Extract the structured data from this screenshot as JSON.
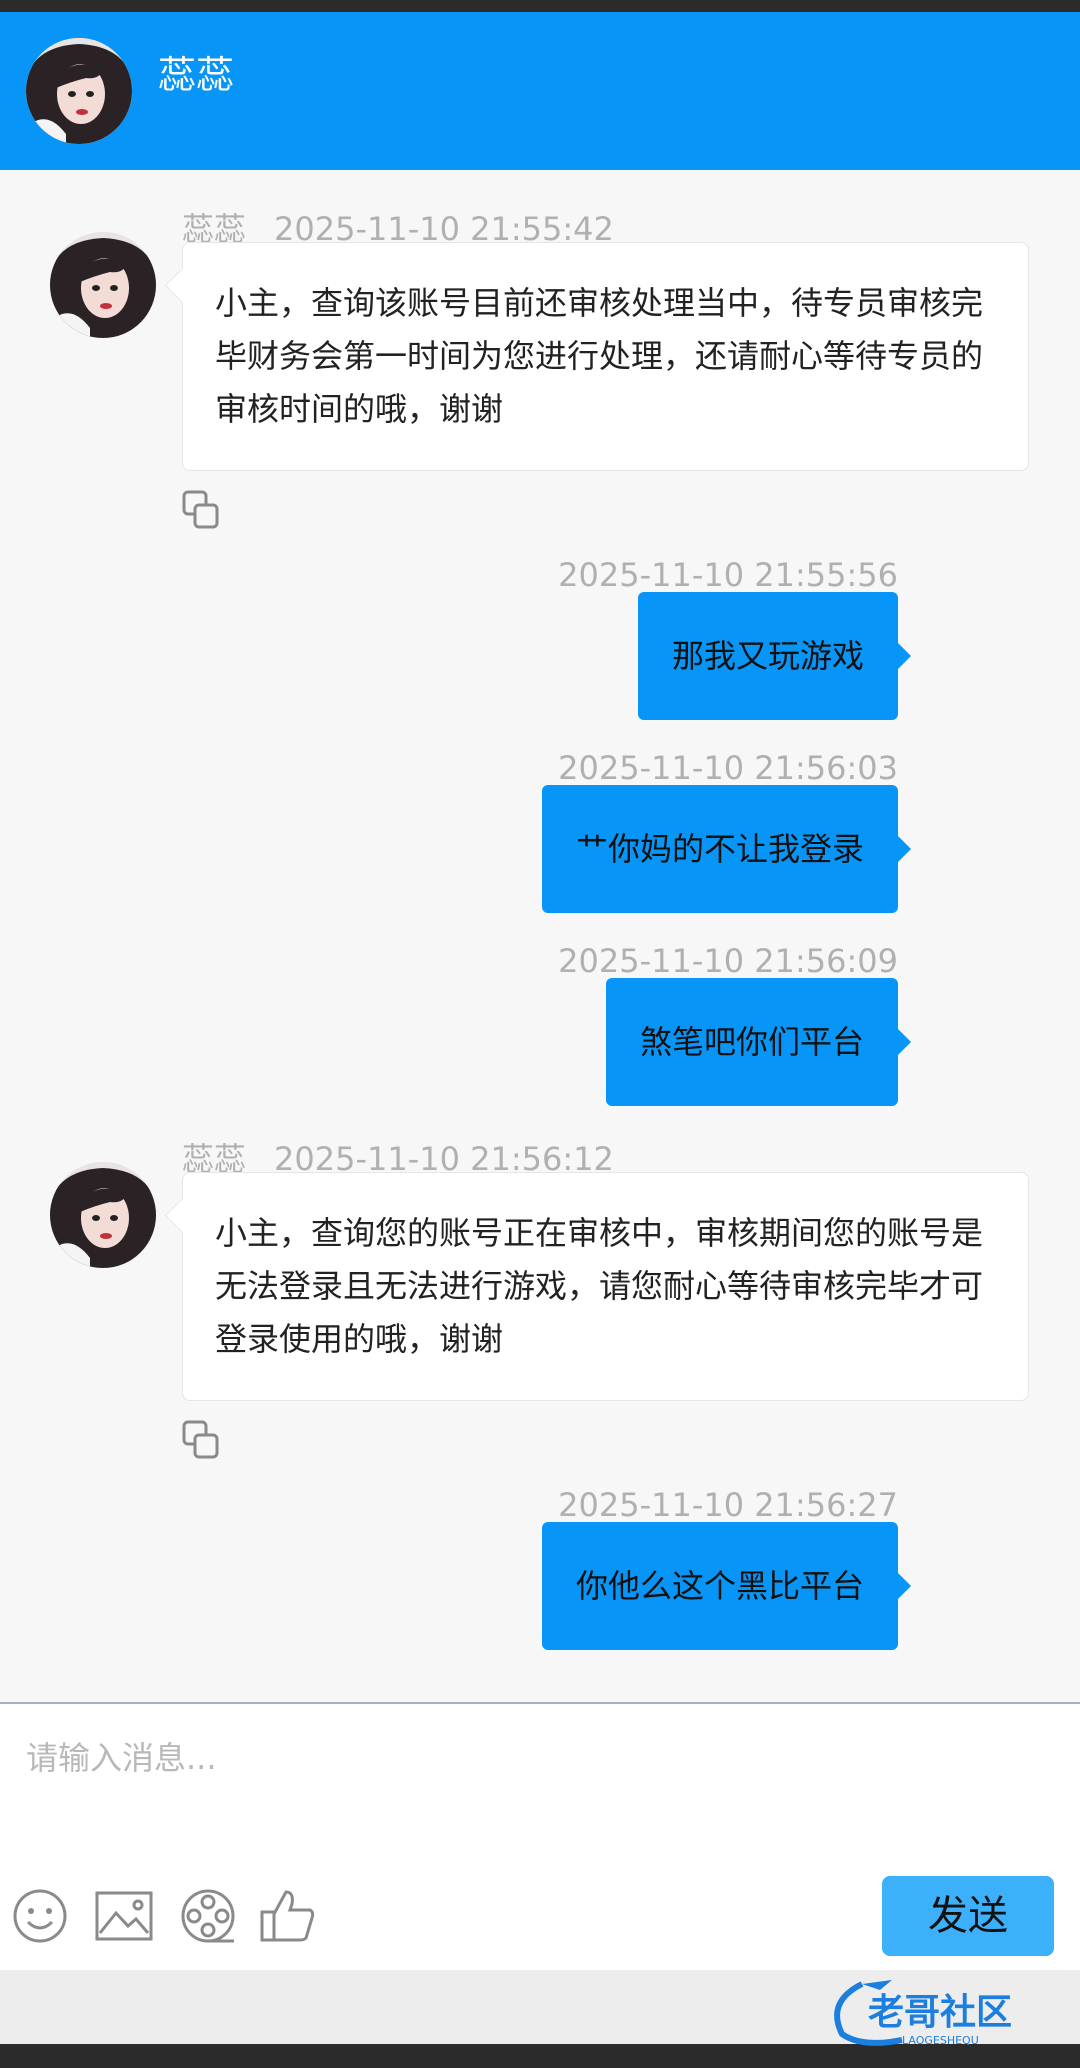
{
  "header": {
    "name": "蕊蕊"
  },
  "messages": [
    {
      "direction": "in",
      "sender": "蕊蕊",
      "time": "2025-11-10 21:55:42",
      "text": "小主，查询该账号目前还审核处理当中，待专员审核完毕财务会第一时间为您进行处理，还请耐心等待专员的审核时间的哦，谢谢"
    },
    {
      "direction": "out",
      "time": "2025-11-10 21:55:56",
      "text": "那我又玩游戏"
    },
    {
      "direction": "out",
      "time": "2025-11-10 21:56:03",
      "text": "艹你妈的不让我登录"
    },
    {
      "direction": "out",
      "time": "2025-11-10 21:56:09",
      "text": "煞笔吧你们平台"
    },
    {
      "direction": "in",
      "sender": "蕊蕊",
      "time": "2025-11-10 21:56:12",
      "text": "小主，查询您的账号正在审核中，审核期间您的账号是无法登录且无法进行游戏，请您耐心等待审核完毕才可登录使用的哦，谢谢"
    },
    {
      "direction": "out",
      "time": "2025-11-10 21:56:27",
      "text": "你他么这个黑比平台"
    }
  ],
  "composer": {
    "placeholder": "请输入消息...",
    "send_label": "发送",
    "tools": [
      "emoji-icon",
      "image-icon",
      "video-icon",
      "thumbs-up-icon"
    ]
  },
  "watermark": {
    "text": "老哥社区",
    "subtext": "LAOGESHEQU"
  },
  "colors": {
    "accent": "#0796f7",
    "send_button": "#3db0fb",
    "background": "#f7f7f7"
  }
}
